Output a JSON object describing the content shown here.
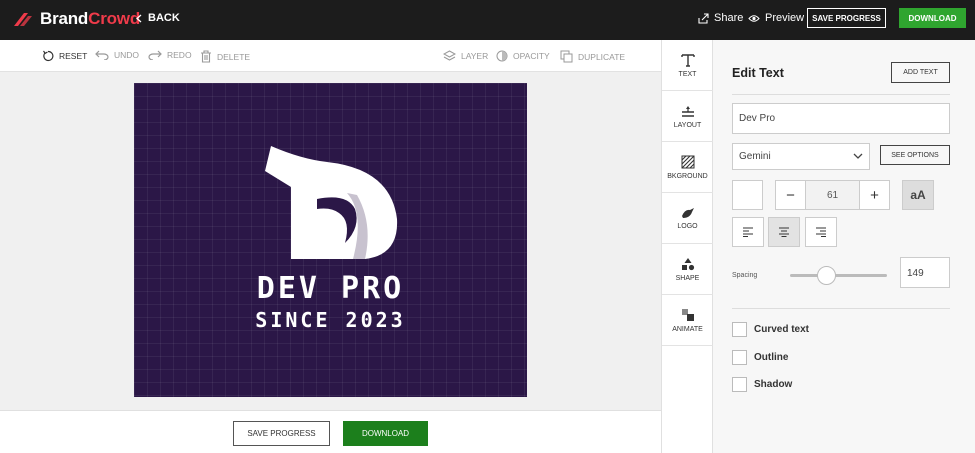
{
  "app": {
    "brand_part1": "Brand",
    "brand_part2": "Crowd",
    "back_label": "BACK",
    "share_label": "Share",
    "preview_label": "Preview",
    "save_progress_label": "SAVE PROGRESS",
    "download_label": "DOWNLOAD"
  },
  "toolbar": {
    "reset": "RESET",
    "undo": "UNDO",
    "redo": "REDO",
    "delete": "DELETE",
    "layer": "LAYER",
    "opacity": "OPACITY",
    "duplicate": "DUPLICATE"
  },
  "design": {
    "line1": "DEV PRO",
    "line2": "SINCE 2023",
    "background_color": "#2b1747"
  },
  "bottom": {
    "save_progress_label": "SAVE PROGRESS",
    "download_label": "DOWNLOAD"
  },
  "side_tabs": [
    {
      "label": "TEXT",
      "icon": "text-t-icon"
    },
    {
      "label": "LAYOUT",
      "icon": "layout-icon"
    },
    {
      "label": "BKGROUND",
      "icon": "background-pattern-icon"
    },
    {
      "label": "LOGO",
      "icon": "logo-icon"
    },
    {
      "label": "SHAPE",
      "icon": "shapes-icon"
    },
    {
      "label": "ANIMATE",
      "icon": "animate-icon"
    }
  ],
  "panel": {
    "title": "Edit Text",
    "add_text_label": "ADD TEXT",
    "text_value": "Dev Pro",
    "font_value": "Gemini",
    "see_options_label": "SEE OPTIONS",
    "font_size": "61",
    "minus": "−",
    "plus": "+",
    "case_label": "aA",
    "spacing_label": "Spacing",
    "spacing_value": "149",
    "spacing_level_percent": 38,
    "checkboxes": [
      "Curved text",
      "Outline",
      "Shadow"
    ]
  },
  "colors": {
    "topbar": "#1c1c1c",
    "brand_accent": "#ef3b4a",
    "download_green": "#2fa52f",
    "bottom_download_green": "#1c7f1c"
  }
}
